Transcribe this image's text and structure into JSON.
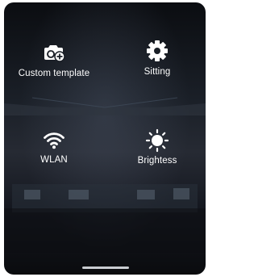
{
  "tiles": [
    {
      "label": "Custom template",
      "icon": "camera-add-icon"
    },
    {
      "label": "Sitting",
      "icon": "gear-icon"
    },
    {
      "label": "WLAN",
      "icon": "wifi-icon"
    },
    {
      "label": "Brightess",
      "icon": "sun-icon"
    }
  ],
  "colors": {
    "text": "#ffffff",
    "background": "#14171d",
    "indicator": "#c9ccd1"
  }
}
